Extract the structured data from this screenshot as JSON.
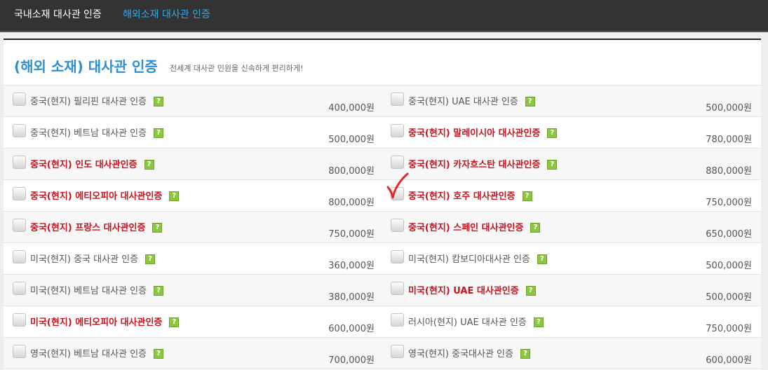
{
  "nav": {
    "tabs": [
      {
        "label": "국내소재 대사관 인증",
        "active": false
      },
      {
        "label": "해외소재 대사관 인증",
        "active": true
      }
    ]
  },
  "header": {
    "title": "(해외 소재) 대사관 인증",
    "subtitle": "전세계 대사관 민원을 신속하게 편리하게!"
  },
  "help_label": "?",
  "colors": {
    "accent_blue": "#2a8fd6",
    "highlight_red": "#c8141e",
    "help_green": "#8dc63f",
    "nav_bg": "#333333",
    "check_mark": "#e8252b"
  },
  "annotation": {
    "icon": "red-checkmark-icon",
    "target": "중국(현지) 호주 대사관인증"
  },
  "rows": [
    {
      "left": {
        "label": "중국(현지) 필리핀 대사관 인증",
        "price": "400,000원",
        "highlight": false
      },
      "right": {
        "label": "중국(현지) UAE 대사관 인증",
        "price": "500,000원",
        "highlight": false
      }
    },
    {
      "left": {
        "label": "중국(현지) 베트남 대사관 인증",
        "price": "500,000원",
        "highlight": false
      },
      "right": {
        "label": "중국(현지) 말레이시아 대사관인증",
        "price": "780,000원",
        "highlight": true
      }
    },
    {
      "left": {
        "label": "중국(현지) 인도 대사관인증",
        "price": "800,000원",
        "highlight": true
      },
      "right": {
        "label": "중국(현지) 카자흐스탄 대사관인증",
        "price": "880,000원",
        "highlight": true
      }
    },
    {
      "left": {
        "label": "중국(현지) 에티오피아 대사관인증",
        "price": "800,000원",
        "highlight": true
      },
      "right": {
        "label": "중국(현지) 호주 대사관인증",
        "price": "750,000원",
        "highlight": true
      }
    },
    {
      "left": {
        "label": "중국(현지) 프랑스 대사관인증",
        "price": "750,000원",
        "highlight": true
      },
      "right": {
        "label": "중국(현지) 스페인 대사관인증",
        "price": "650,000원",
        "highlight": true
      }
    },
    {
      "left": {
        "label": "미국(현지) 중국 대사관 인증",
        "price": "360,000원",
        "highlight": false
      },
      "right": {
        "label": "미국(현지) 캄보디아대사관 인증",
        "price": "500,000원",
        "highlight": false
      }
    },
    {
      "left": {
        "label": "미국(현지) 베트남 대사관 인증",
        "price": "380,000원",
        "highlight": false
      },
      "right": {
        "label": "미국(현지) UAE 대사관인증",
        "price": "500,000원",
        "highlight": true
      }
    },
    {
      "left": {
        "label": "미국(현지) 에티오피아 대사관인증",
        "price": "600,000원",
        "highlight": true
      },
      "right": {
        "label": "러시아(현지) UAE 대사관 인증",
        "price": "750,000원",
        "highlight": false
      }
    },
    {
      "left": {
        "label": "영국(현지) 베트남 대사관 인증",
        "price": "700,000원",
        "highlight": false
      },
      "right": {
        "label": "영국(현지) 중국대사관 인증",
        "price": "600,000원",
        "highlight": false
      }
    }
  ]
}
